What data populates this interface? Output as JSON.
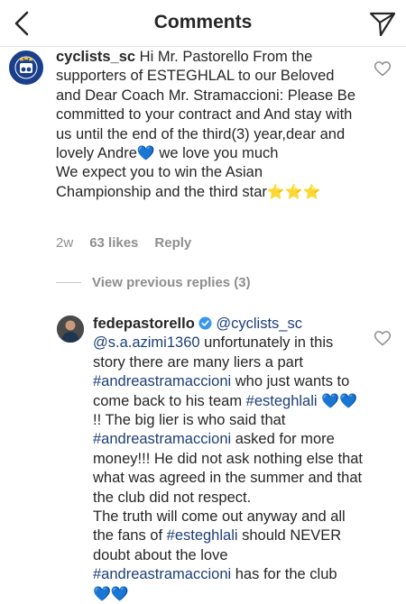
{
  "header": {
    "title": "Comments",
    "back_icon": "chevron-left-icon",
    "send_icon": "paper-plane-icon"
  },
  "comments": [
    {
      "username": "cyclists_sc",
      "avatar": "club-logo-avatar",
      "text_parts": {
        "p1": " Hi Mr. Pastorello From the supporters of ESTEGHLAL to our Beloved and Dear Coach Mr. Stramaccioni: Please Be committed to your contract and And stay with us until the end of the third(3) year,dear and lovely Andre",
        "p1_emoji": "💙",
        "p1_end": " we love you much",
        "p2": "We expect you to win the Asian Championship and the third star",
        "p2_emoji": "⭐⭐⭐"
      },
      "time": "2w",
      "likes": "63 likes",
      "reply": "Reply"
    },
    {
      "view_replies": "View previous replies (3)"
    },
    {
      "username": "fedepastorello",
      "verified": true,
      "avatar": "profile-photo-avatar",
      "text_parts": {
        "mention1": "@cyclists_sc",
        "mention2": "@s.a.azimi1360",
        "t1": " unfortunately in this story there are many liers a part ",
        "hashtag1": "#andreastramaccioni",
        "t2": " who just wants to come back to his team ",
        "hashtag2": "#esteghlali",
        "emoji1": "💙💙",
        "t3": " !! The big lier is who said that ",
        "hashtag3": "#andreastramaccioni",
        "t4": " asked for more money!!! He did not ask nothing else that what was agreed in the summer and that the club did not respect.",
        "t5": "The truth will come out anyway and all the fans of ",
        "hashtag4": "#esteghlali",
        "t6": " should NEVER doubt about the love ",
        "hashtag5": "#andreastramaccioni",
        "t7": " has for the club",
        "emoji2": "💙💙"
      }
    }
  ],
  "colors": {
    "link": "#1d3f77",
    "meta": "#8e8e8e",
    "verified": "#3897f0",
    "heart": "#2a7de1"
  }
}
